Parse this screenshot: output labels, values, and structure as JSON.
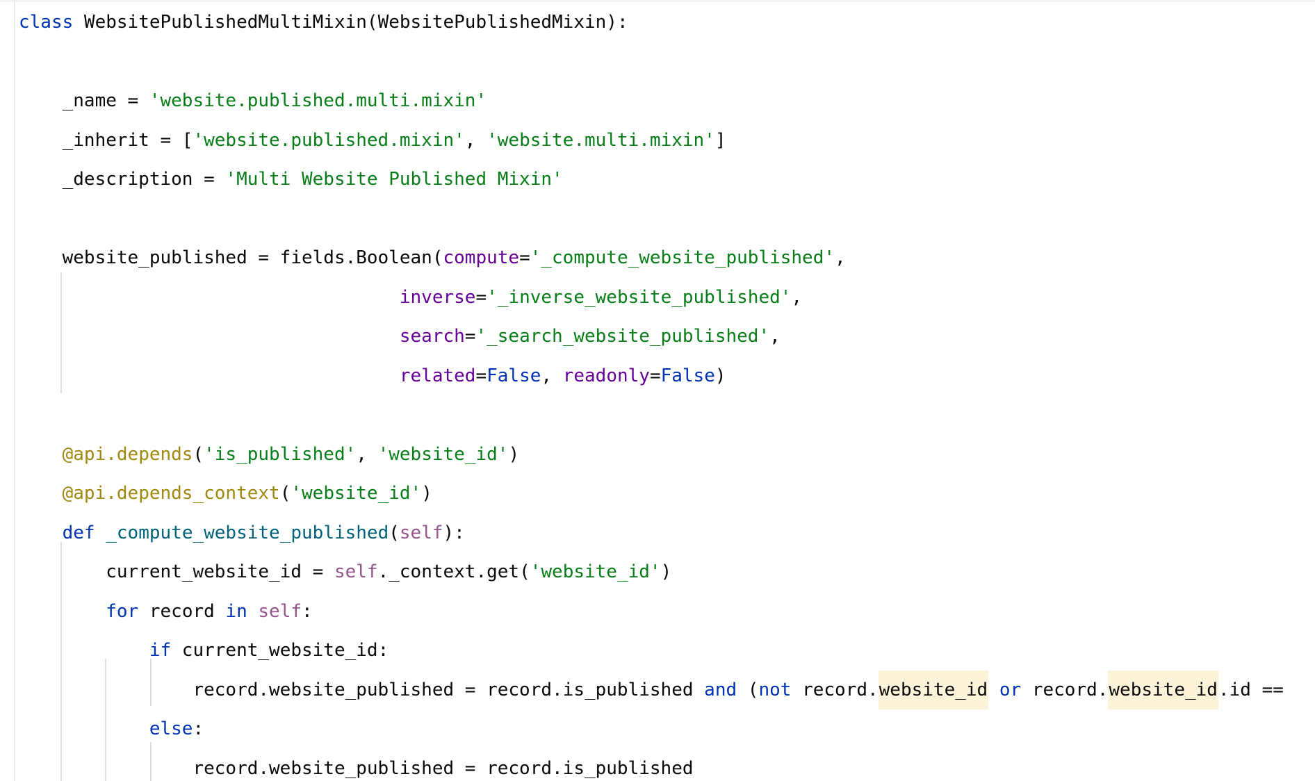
{
  "editor": {
    "language": "Python",
    "lines": [
      [
        {
          "t": "class",
          "c": "kw"
        },
        {
          "t": " WebsitePublishedMultiMixin(WebsitePublishedMixin):"
        }
      ],
      [],
      [
        {
          "t": "    _name = "
        },
        {
          "t": "'website.published.multi.mixin'",
          "c": "str"
        }
      ],
      [
        {
          "t": "    _inherit = ["
        },
        {
          "t": "'website.published.mixin'",
          "c": "str"
        },
        {
          "t": ", "
        },
        {
          "t": "'website.multi.mixin'",
          "c": "str"
        },
        {
          "t": "]"
        }
      ],
      [
        {
          "t": "    _description = "
        },
        {
          "t": "'Multi Website Published Mixin'",
          "c": "str"
        }
      ],
      [],
      [
        {
          "t": "    website_published = fields.Boolean("
        },
        {
          "t": "compute",
          "c": "param"
        },
        {
          "t": "="
        },
        {
          "t": "'_compute_website_published'",
          "c": "str"
        },
        {
          "t": ","
        }
      ],
      [
        {
          "t": "                                   "
        },
        {
          "t": "inverse",
          "c": "param"
        },
        {
          "t": "="
        },
        {
          "t": "'_inverse_website_published'",
          "c": "str"
        },
        {
          "t": ","
        }
      ],
      [
        {
          "t": "                                   "
        },
        {
          "t": "search",
          "c": "param"
        },
        {
          "t": "="
        },
        {
          "t": "'_search_website_published'",
          "c": "str"
        },
        {
          "t": ","
        }
      ],
      [
        {
          "t": "                                   "
        },
        {
          "t": "related",
          "c": "param"
        },
        {
          "t": "="
        },
        {
          "t": "False",
          "c": "kw"
        },
        {
          "t": ", "
        },
        {
          "t": "readonly",
          "c": "param"
        },
        {
          "t": "="
        },
        {
          "t": "False",
          "c": "kw"
        },
        {
          "t": ")"
        }
      ],
      [],
      [
        {
          "t": "    "
        },
        {
          "t": "@api.depends",
          "c": "deco"
        },
        {
          "t": "("
        },
        {
          "t": "'is_published'",
          "c": "str"
        },
        {
          "t": ", "
        },
        {
          "t": "'website_id'",
          "c": "str"
        },
        {
          "t": ")"
        }
      ],
      [
        {
          "t": "    "
        },
        {
          "t": "@api.depends_context",
          "c": "deco"
        },
        {
          "t": "("
        },
        {
          "t": "'website_id'",
          "c": "str"
        },
        {
          "t": ")"
        }
      ],
      [
        {
          "t": "    "
        },
        {
          "t": "def",
          "c": "kw"
        },
        {
          "t": " "
        },
        {
          "t": "_compute_website_published",
          "c": "fn"
        },
        {
          "t": "("
        },
        {
          "t": "self",
          "c": "self"
        },
        {
          "t": "):"
        }
      ],
      [
        {
          "t": "        current_website_id = "
        },
        {
          "t": "self",
          "c": "self"
        },
        {
          "t": "._context.get("
        },
        {
          "t": "'website_id'",
          "c": "str"
        },
        {
          "t": ")"
        }
      ],
      [
        {
          "t": "        "
        },
        {
          "t": "for",
          "c": "kw"
        },
        {
          "t": " record "
        },
        {
          "t": "in",
          "c": "kw"
        },
        {
          "t": " "
        },
        {
          "t": "self",
          "c": "self"
        },
        {
          "t": ":"
        }
      ],
      [
        {
          "t": "            "
        },
        {
          "t": "if",
          "c": "kw"
        },
        {
          "t": " current_website_id:"
        }
      ],
      [
        {
          "t": "                record.website_published = record.is_published "
        },
        {
          "t": "and",
          "c": "kw"
        },
        {
          "t": " ("
        },
        {
          "t": "not",
          "c": "kw"
        },
        {
          "t": " record."
        },
        {
          "t": "website_id",
          "c": "hl"
        },
        {
          "t": " "
        },
        {
          "t": "or",
          "c": "kw"
        },
        {
          "t": " record."
        },
        {
          "t": "website_id",
          "c": "hl"
        },
        {
          "t": ".id =="
        }
      ],
      [
        {
          "t": "            "
        },
        {
          "t": "else",
          "c": "kw"
        },
        {
          "t": ":"
        }
      ],
      [
        {
          "t": "                record.website_published = record.is_published"
        }
      ]
    ]
  }
}
